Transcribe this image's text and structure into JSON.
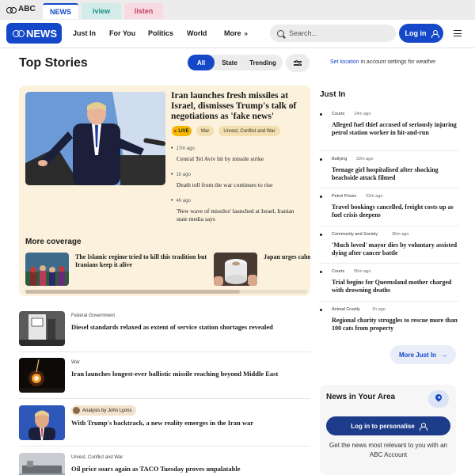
{
  "network": {
    "brand": "ABC",
    "tabs": [
      {
        "label": "NEWS"
      },
      {
        "label": "iview"
      },
      {
        "label": "listen"
      }
    ]
  },
  "header": {
    "nav": [
      {
        "label": "Just In"
      },
      {
        "label": "For You"
      },
      {
        "label": "Politics"
      },
      {
        "label": "World"
      },
      {
        "label": "More"
      }
    ],
    "search_placeholder": "Search...",
    "login_label": "Log in",
    "logo_text": "NEWS"
  },
  "top_stories": {
    "title": "Top Stories",
    "filters": [
      {
        "label": "All",
        "active": true
      },
      {
        "label": "State",
        "active": false
      },
      {
        "label": "Trending",
        "active": false
      }
    ],
    "settings_link": "Set location",
    "settings_rest": " in account settings for weather"
  },
  "hero": {
    "title": "Iran launches fresh missiles at Israel, dismisses Trump's talk of negotiations as 'fake news'",
    "tags": [
      "LIVE",
      "War",
      "Unrest, Conflict and War"
    ],
    "bullets": [
      {
        "time": "17m ago",
        "text": "Central Tel Aviv hit by missile strike"
      },
      {
        "time": "1h ago",
        "text": "Death toll from the war continues to rise"
      },
      {
        "time": "4h ago",
        "text": "'New wave of missiles' launched at Israel, Iranian state media says"
      }
    ],
    "more_coverage_label": "More coverage",
    "coverage": [
      {
        "text": "The Islamic regime tried to kill this tradition but Iranians keep it alive"
      },
      {
        "text": "Japan urges calm amid toilet paper shel..."
      }
    ],
    "scroll_fraction": 0.76
  },
  "stories": [
    {
      "category": "Federal Government",
      "title": "Diesel standards relaxed as extent of service station shortages revealed"
    },
    {
      "category": "War",
      "title": "Iran launches longest-ever ballistic missile reaching beyond Middle East"
    },
    {
      "category": "Analysis by John Lyons",
      "title": "With Trump's backtrack, a new reality emerges in the Iran war"
    },
    {
      "category": "Unrest, Conflict and War",
      "title": "Oil price soars again as TACO Tuesday proves unpalatable"
    }
  ],
  "just_in": {
    "title": "Just In",
    "items": [
      {
        "category": "Courts",
        "time": "14m ago",
        "title": "Alleged fuel thief accused of seriously injuring petrol station worker in hit-and-run"
      },
      {
        "category": "Bullying",
        "time": "22m ago",
        "title": "Teenage girl hospitalised after shocking beachside attack filmed"
      },
      {
        "category": "Petrol Prices",
        "time": "22m ago",
        "title": "Travel bookings cancelled, freight costs up as fuel crisis deepens"
      },
      {
        "category": "Community and Society",
        "time": "36m ago",
        "title": "'Much loved' mayor dies by voluntary assisted dying after cancer battle"
      },
      {
        "category": "Courts",
        "time": "55m ago",
        "title": "Trial begins for Queensland mother charged with drowning deaths"
      },
      {
        "category": "Animal Cruelty",
        "time": "1h ago",
        "title": "Regional charity struggles to rescue more than 100 cats from property"
      }
    ],
    "more_label": "More Just In"
  },
  "area": {
    "title": "News in Your Area",
    "button_label": "Log in to personalise",
    "message": "Get the news most relevant to you with an ABC Account"
  },
  "colors": {
    "brand_blue": "#1448c8",
    "hero_bg": "#fbf1dc",
    "live_tag": "#f4b900",
    "dark_button": "#1c3b89"
  }
}
